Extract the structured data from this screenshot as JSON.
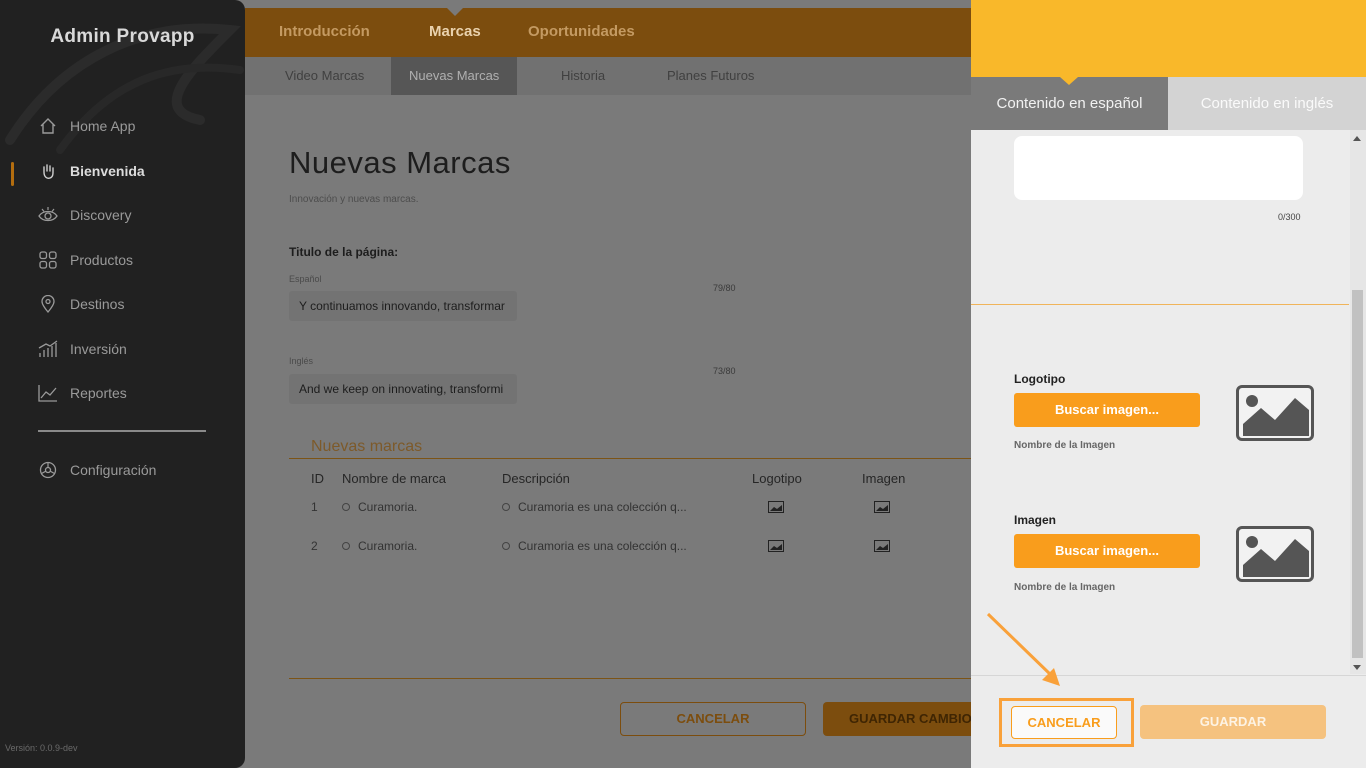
{
  "sidebar": {
    "brand": "Admin Provapp",
    "items": [
      {
        "label": "Home App",
        "icon": "home-icon"
      },
      {
        "label": "Bienvenida",
        "icon": "waving-hand-icon",
        "active": true
      },
      {
        "label": "Discovery",
        "icon": "eye-icon"
      },
      {
        "label": "Productos",
        "icon": "grid-icon"
      },
      {
        "label": "Destinos",
        "icon": "location-pin-icon"
      },
      {
        "label": "Inversión",
        "icon": "bar-chart-icon"
      },
      {
        "label": "Reportes",
        "icon": "line-chart-icon"
      }
    ],
    "settings": {
      "label": "Configuración",
      "icon": "gear-icon"
    },
    "version": "Versión: 0.0.9-dev"
  },
  "topnav": {
    "tabs": [
      "Introducción",
      "Marcas",
      "Oportunidades"
    ],
    "active": "Marcas"
  },
  "subnav": {
    "tabs": [
      "Video Marcas",
      "Nuevas Marcas",
      "Historia",
      "Planes Futuros"
    ],
    "active": "Nuevas Marcas"
  },
  "main": {
    "title": "Nuevas Marcas",
    "subtitle": "Innovación y nuevas marcas.",
    "page_title_label": "Titulo de la página:",
    "spanish_label": "Español",
    "spanish_value": "Y continuamos innovando, transformar",
    "spanish_count": "79/80",
    "english_label": "Inglés",
    "english_value": "And we keep on innovating, transformi",
    "english_count": "73/80",
    "section_title": "Nuevas marcas",
    "table": {
      "headers": [
        "ID",
        "Nombre de marca",
        "Descripción",
        "Logotipo",
        "Imagen"
      ],
      "rows": [
        {
          "id": "1",
          "name": "Curamoria.",
          "description": "Curamoria es una colección q..."
        },
        {
          "id": "2",
          "name": "Curamoria.",
          "description": "Curamoria es una colección q..."
        }
      ]
    },
    "cancel_label": "CANCELAR",
    "save_label": "GUARDAR CAMBIOS"
  },
  "panel": {
    "tabs": {
      "spanish": "Contenido en español",
      "english": "Contenido en inglés"
    },
    "char_count": "0/300",
    "logo": {
      "label": "Logotipo",
      "button": "Buscar imagen...",
      "image_name": "Nombre de la Imagen"
    },
    "image": {
      "label": "Imagen",
      "button": "Buscar imagen...",
      "image_name": "Nombre de la Imagen"
    },
    "cancel_label": "CANCELAR",
    "save_label": "GUARDAR"
  },
  "colors": {
    "accent": "#f99d1c",
    "header_yellow": "#f9b82a",
    "sidebar_bg": "#212121",
    "highlight": "#f9a13a"
  }
}
